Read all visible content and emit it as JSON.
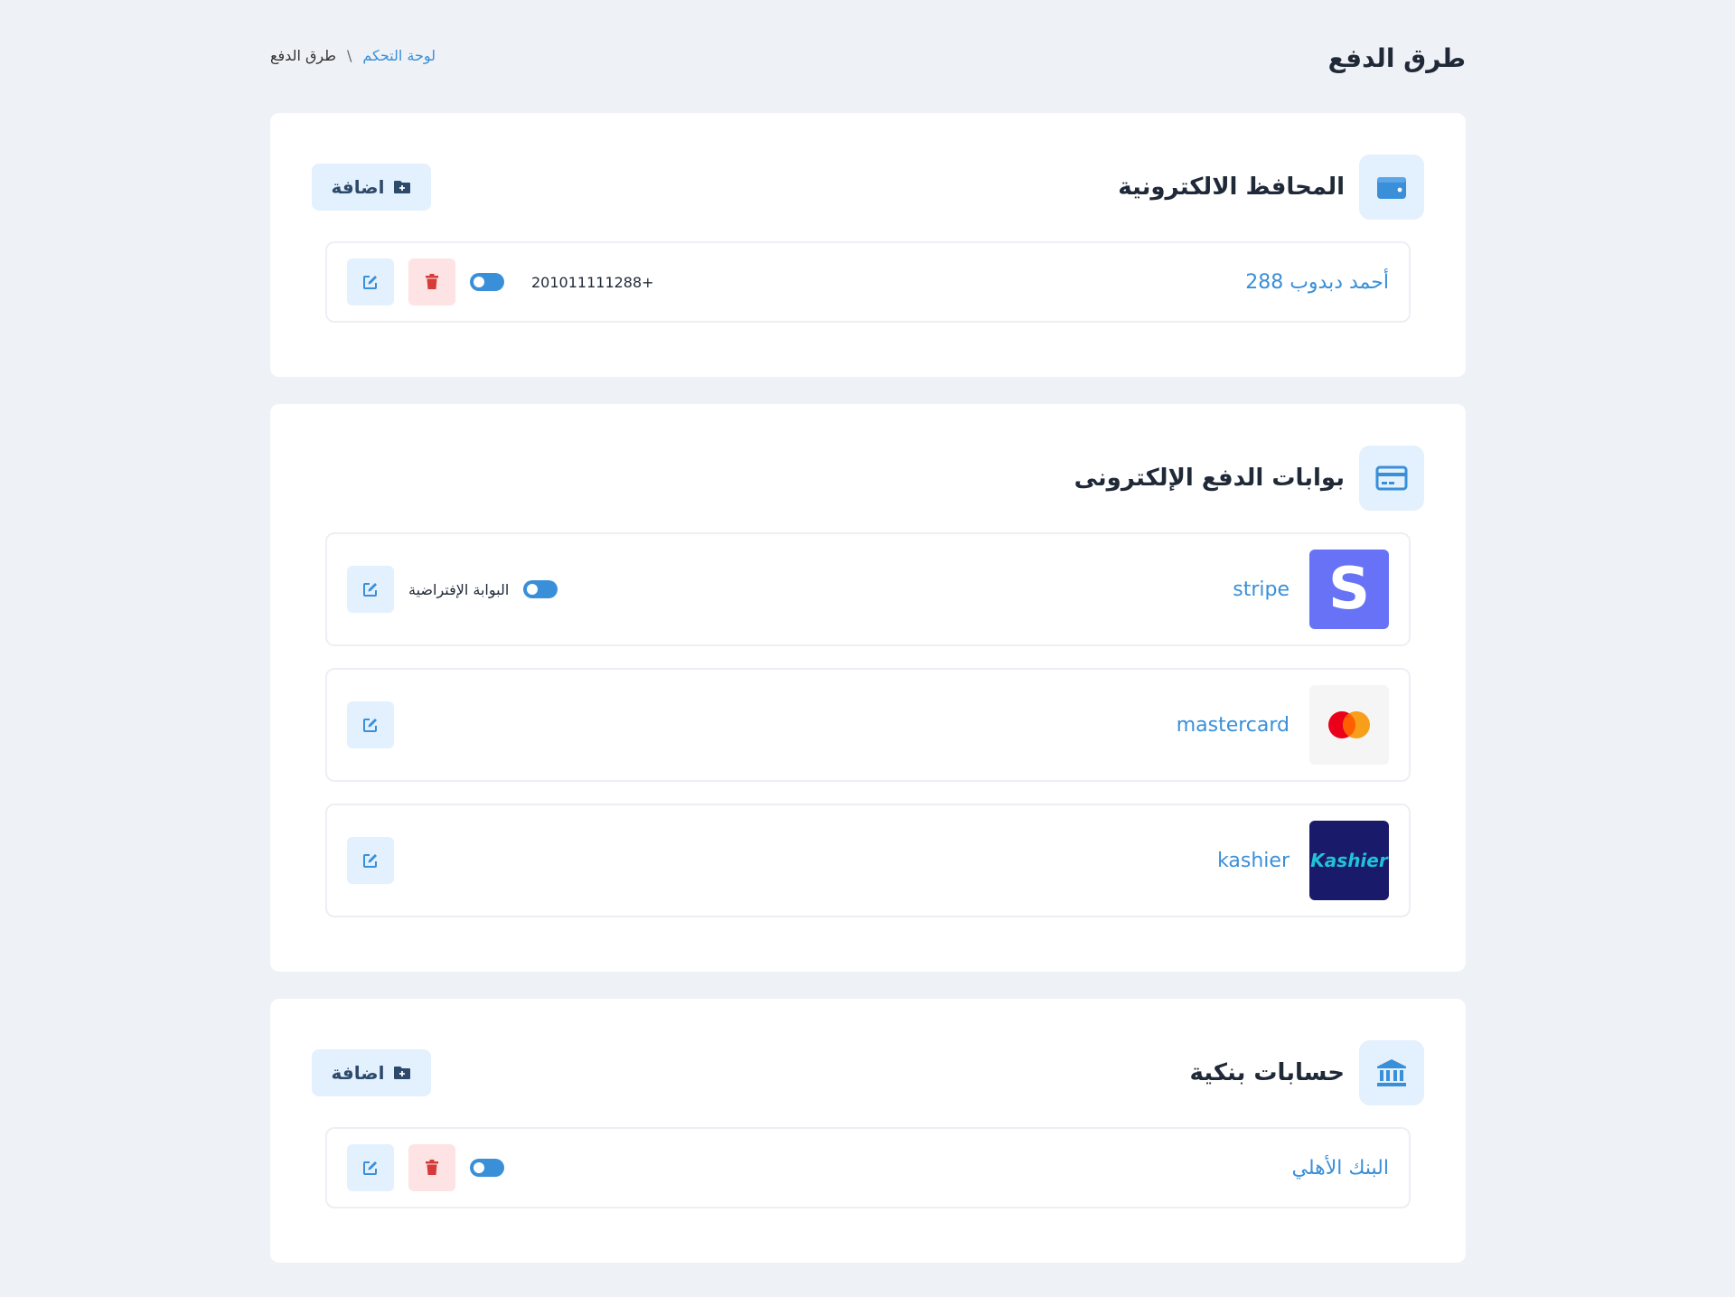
{
  "header": {
    "page_title": "طرق الدفع",
    "breadcrumb": {
      "home": "لوحة التحكم",
      "separator": "\\",
      "current": "طرق الدفع"
    }
  },
  "wallets": {
    "title": "المحافظ الالكترونية",
    "icon": "wallet-icon",
    "add_label": "اضافة",
    "items": [
      {
        "name": "أحمد دبدوب 288",
        "phone": "201011111288+",
        "active": true
      }
    ]
  },
  "gateways": {
    "title": "بوابات الدفع الإلكترونى",
    "icon": "credit-card-icon",
    "default_label": "البوابة الإفتراضية",
    "items": [
      {
        "name": "stripe",
        "logo": "stripe-logo",
        "logo_text": "S",
        "is_default": true
      },
      {
        "name": "mastercard",
        "logo": "mastercard-logo"
      },
      {
        "name": "kashier",
        "logo": "kashier-logo",
        "logo_text": "Kashier"
      }
    ]
  },
  "banks": {
    "title": "حسابات بنكية",
    "icon": "bank-icon",
    "add_label": "اضافة",
    "items": [
      {
        "name": "البنك الأهلي",
        "active": true
      }
    ]
  },
  "colors": {
    "accent": "#3a8fd9",
    "background": "#eef1f5",
    "icon_bg": "#e3f0fd",
    "danger": "#d63b3b",
    "danger_bg": "#fde3e3",
    "stripe": "#6772f6",
    "kashier": "#1a1a6b"
  }
}
